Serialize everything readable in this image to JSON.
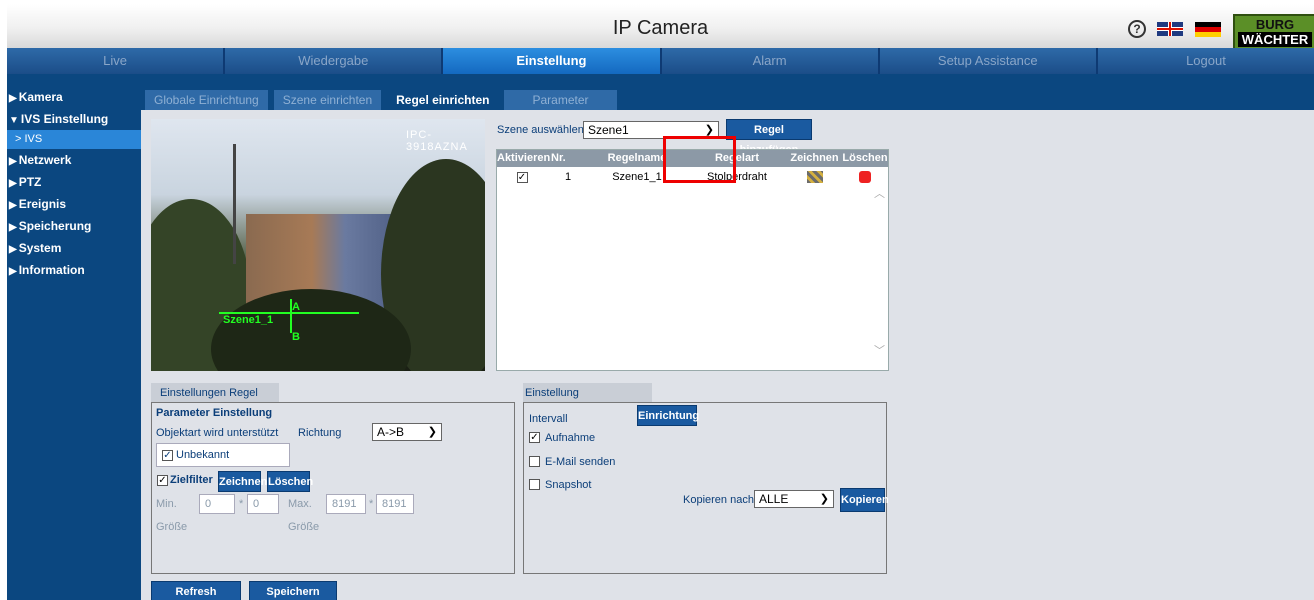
{
  "header": {
    "title": "IP Camera",
    "help_symbol": "?",
    "logo_line1": "BURG",
    "logo_line2": "WÄCHTER"
  },
  "nav": {
    "tabs": [
      "Live",
      "Wiedergabe",
      "Einstellung",
      "Alarm",
      "Setup Assistance",
      "Logout"
    ],
    "active": "Einstellung"
  },
  "sidebar": {
    "items": [
      "Kamera",
      "IVS Einstellung",
      "Netzwerk",
      "PTZ",
      "Ereignis",
      "Speicherung",
      "System",
      "Information"
    ],
    "sub_item": "> IVS"
  },
  "subtabs": [
    "Globale Einrichtung",
    "Szene einrichten",
    "Regel einrichten",
    "Parameter"
  ],
  "video": {
    "overlay": "IPC-3918AZNA",
    "rule_label": "Szene1_1",
    "point_a": "A",
    "point_b": "B"
  },
  "scene": {
    "label": "Szene auswählen",
    "value": "Szene1",
    "add_rule_button": "Regel hinzufügen"
  },
  "rule_table": {
    "headers": [
      "Aktivieren",
      "Nr.",
      "Regelname",
      "Regelart",
      "Zeichnen",
      "Löschen"
    ],
    "rows": [
      {
        "enabled": "✓",
        "nr": "1",
        "name": "Szene1_1",
        "type": "Stolperdraht"
      }
    ]
  },
  "rule_settings": {
    "tab": "Einstellungen Regel",
    "section": "Parameter Einstellung",
    "object_label": "Objektart wird unterstützt",
    "direction_label": "Richtung",
    "direction_value": "A->B",
    "object_value": "Unbekannt",
    "target_filter": "Zielfilter",
    "draw_button": "Zeichnen",
    "delete_button": "Löschen",
    "min_label": "Min.",
    "max_label": "Max.",
    "min_w": "0",
    "min_h": "0",
    "max_w": "8191",
    "max_h": "8191",
    "times": "*",
    "size_label": "Größe"
  },
  "alarm_settings": {
    "tab": "Einstellung Alarmaktivierung",
    "interval_label": "Intervall",
    "setup_button": "Einrichtung",
    "record": "Aufnahme",
    "email": "E-Mail senden",
    "snapshot": "Snapshot",
    "copy_label": "Kopieren nach",
    "copy_value": "ALLE",
    "copy_button": "Kopieren"
  },
  "footer": {
    "refresh": "Refresh",
    "save": "Speichern"
  },
  "colors": {
    "nav_bg": "#0e3a73",
    "active_tab": "#1469c0",
    "body_bg": "#0b4780",
    "highlight": "#ee0000"
  }
}
